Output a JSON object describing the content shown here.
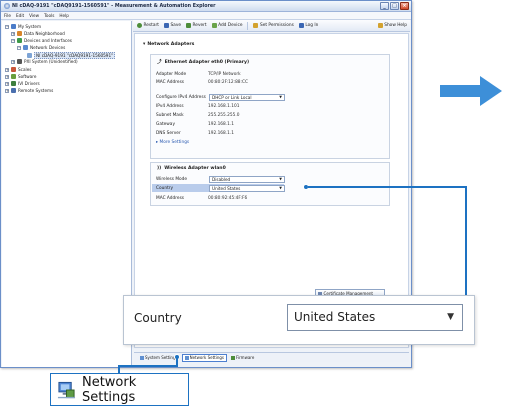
{
  "window": {
    "title": "NI cDAQ-9191 \"cDAQ9191-1560591\" - Measurement & Automation Explorer",
    "menu": [
      "File",
      "Edit",
      "View",
      "Tools",
      "Help"
    ]
  },
  "tree": {
    "items": [
      {
        "label": "My System"
      },
      {
        "label": "Data Neighborhood"
      },
      {
        "label": "Devices and Interfaces"
      },
      {
        "label": "Network Devices"
      },
      {
        "label": "NI cDAQ-9191 \"cDAQ9191-1560591\""
      },
      {
        "label": "PXI System (Unidentified)"
      },
      {
        "label": "Scales"
      },
      {
        "label": "Software"
      },
      {
        "label": "IVI Drivers"
      },
      {
        "label": "Remote Systems"
      }
    ]
  },
  "toolbar": {
    "restart": "Restart",
    "save": "Save",
    "revert": "Revert",
    "add_device": "Add Device",
    "set_permissions": "Set Permissions",
    "log_in": "Log In",
    "show_help": "Show Help"
  },
  "network_adapters": {
    "header": "Network Adapters",
    "ethernet": {
      "title": "Ethernet Adapter eth0 (Primary)",
      "adapter_mode_label": "Adapter Mode",
      "adapter_mode_value": "TCP/IP Network",
      "mac_label": "MAC Address",
      "mac_value": "00:80:2F:12:88:CC",
      "configure_label": "Configure IPv4 Address",
      "configure_value": "DHCP or Link Local",
      "ipv4_label": "IPv4 Address",
      "ipv4_value": "192.168.1.101",
      "subnet_label": "Subnet Mask",
      "subnet_value": "255.255.255.0",
      "gateway_label": "Gateway",
      "gateway_value": "192.168.1.1",
      "dns_label": "DNS Server",
      "dns_value": "192.168.1.1",
      "more_settings": "More Settings"
    },
    "wireless": {
      "title": "Wireless Adapter wlan0",
      "mode_label": "Wireless Mode",
      "mode_value": "Disabled",
      "country_label": "Country",
      "country_value": "United States",
      "mac_label": "MAC Address",
      "mac_value": "00:80:92:45:4F:F6"
    },
    "cert_button": "Certificate Management"
  },
  "bottom_tabs": {
    "first": "System Settings",
    "network": "Network Settings",
    "firmware": "Firmware"
  },
  "callouts": {
    "country_label": "Country",
    "country_value": "United States",
    "network_settings": "Network Settings"
  },
  "colors": {
    "accent": "#1d72c2",
    "arrow": "#3d8fd8",
    "selection": "#3f74c9"
  }
}
